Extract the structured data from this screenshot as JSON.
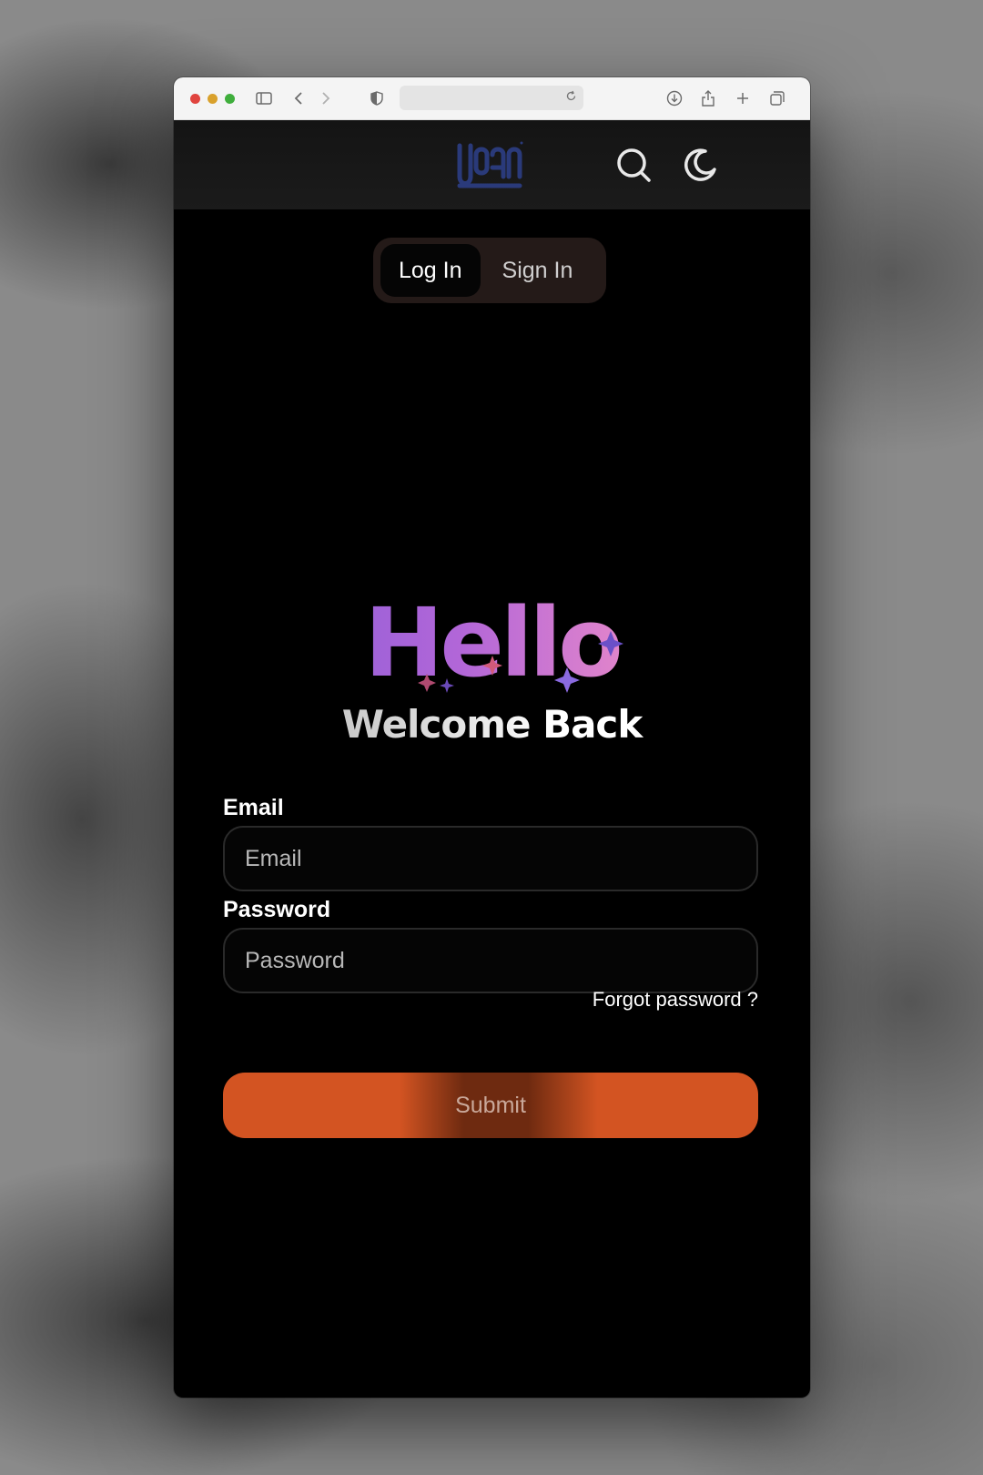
{
  "browser": {
    "icons": [
      "sidebar-icon",
      "back-icon",
      "forward-icon",
      "shield-icon",
      "reload-icon",
      "download-icon",
      "share-icon",
      "new-tab-icon",
      "tabs-overview-icon"
    ]
  },
  "header": {
    "logo_alt": "logo",
    "icons": [
      "search-icon",
      "moon-icon"
    ]
  },
  "tabs": [
    {
      "label": "Log In",
      "active": true
    },
    {
      "label": "Sign In",
      "active": false
    }
  ],
  "hero": {
    "title": "Hello",
    "subtitle": "Welcome Back"
  },
  "form": {
    "email_label": "Email",
    "email_placeholder": "Email",
    "password_label": "Password",
    "password_placeholder": "Password",
    "forgot_link": "Forgot password ?",
    "submit_label": "Submit"
  },
  "colors": {
    "accent": "#d35422",
    "hello_gradient_start": "#7a5bd6",
    "hello_gradient_end": "#f39bc5",
    "logo": "#2a3a7a"
  }
}
